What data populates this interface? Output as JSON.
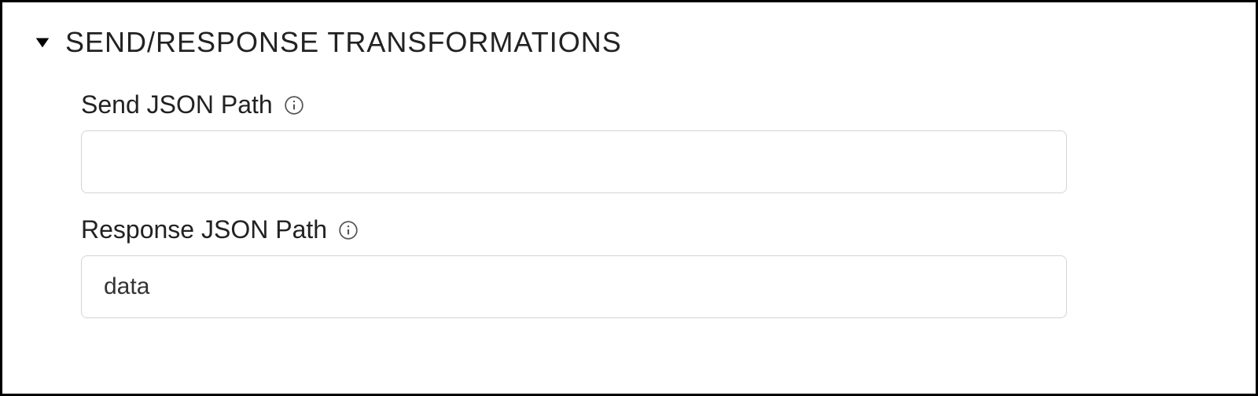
{
  "section": {
    "title": "SEND/RESPONSE TRANSFORMATIONS"
  },
  "fields": {
    "sendJsonPath": {
      "label": "Send JSON Path",
      "value": ""
    },
    "responseJsonPath": {
      "label": "Response JSON Path",
      "value": "data"
    }
  }
}
